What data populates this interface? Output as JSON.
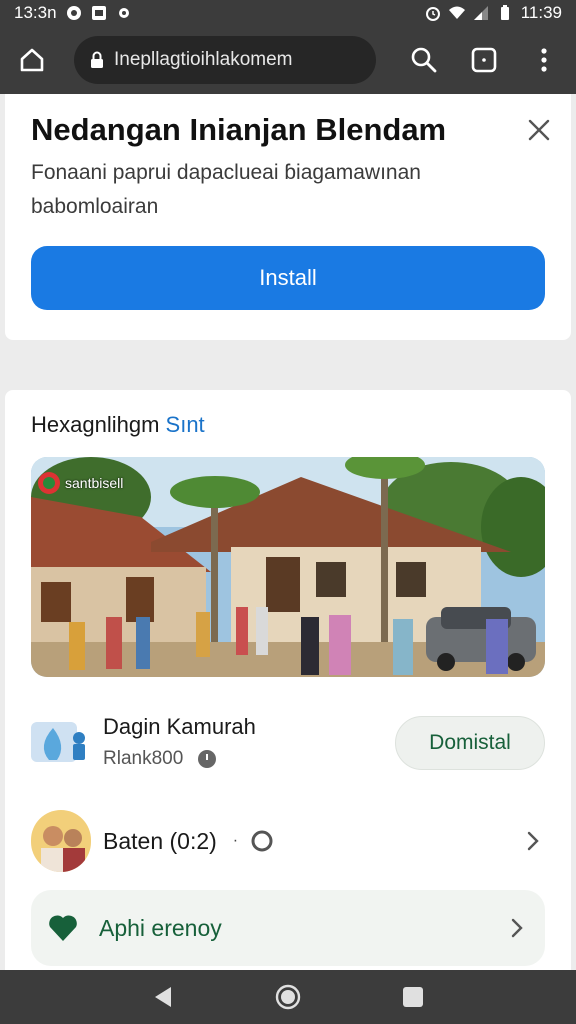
{
  "status": {
    "time_left": "13:3n",
    "time_right": "11:39"
  },
  "browser": {
    "url": "Inepllagtioihlakomem"
  },
  "install_banner": {
    "title": "Nedangan Inianjan Blendam",
    "description": "Fonaani paprui dapaclueai ɓiagamawınan babomloairan",
    "install_label": "Install"
  },
  "section": {
    "title": "Hexagnlihgm",
    "link": "Sınt"
  },
  "photo": {
    "logo_text": "santbisell"
  },
  "app": {
    "name": "Dagin Kamurah",
    "meta": "Rlank800",
    "download_label": "Domistal"
  },
  "rating": {
    "label": "Baten (0:2)",
    "separator": "·"
  },
  "apps_link": {
    "label": "Aphi erenoy"
  },
  "colors": {
    "accent": "#1a7ae3",
    "green": "#17603a",
    "chrome": "#3c3c3c"
  }
}
